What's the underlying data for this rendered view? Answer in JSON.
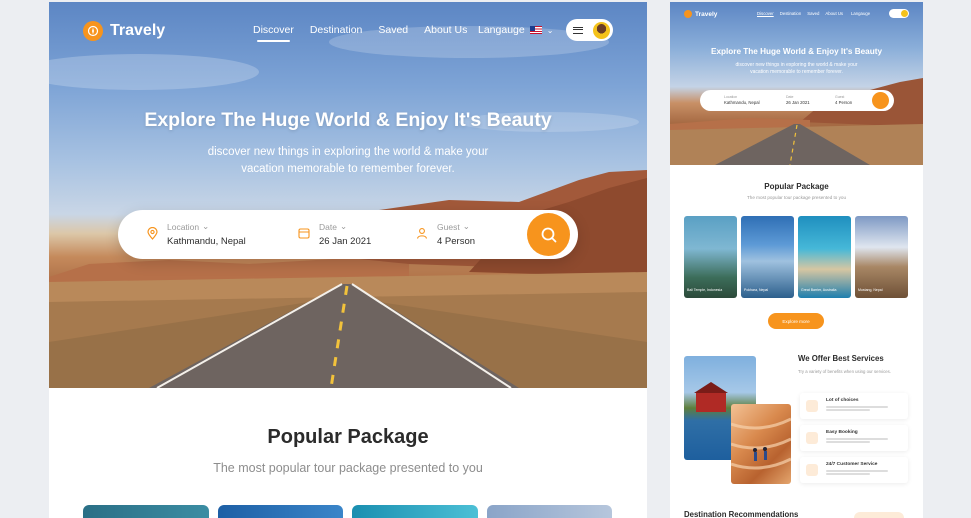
{
  "brand": {
    "name": "Travely",
    "accent": "#f7941d"
  },
  "nav": {
    "items": [
      {
        "label": "Discover",
        "active": true
      },
      {
        "label": "Destination",
        "active": false
      },
      {
        "label": "Saved",
        "active": false
      },
      {
        "label": "About Us",
        "active": false
      }
    ],
    "language_label": "Langauge"
  },
  "hero": {
    "title": "Explore The Huge World & Enjoy It's Beauty",
    "subtitle": "discover new things in exploring the world & make your vacation memorable to remember forever."
  },
  "search": {
    "location": {
      "label": "Location",
      "value": "Kathmandu, Nepal"
    },
    "date": {
      "label": "Date",
      "value": "26 Jan 2021"
    },
    "guest": {
      "label": "Guest",
      "value": "4 Person"
    }
  },
  "popular": {
    "title": "Popular Package",
    "subtitle": "The most popular tour package presented to you"
  },
  "mini": {
    "brand": "Travely",
    "nav": [
      "Discover",
      "Destination",
      "Saved",
      "About Us"
    ],
    "language_label": "Langauge",
    "hero_title": "Explore The Huge World & Enjoy It's Beauty",
    "hero_subtitle": "discover new things in exploring the world & make your vacation memorable to remember forever.",
    "search": [
      {
        "label": "Location",
        "value": "Kathmandu, Nepal"
      },
      {
        "label": "Date",
        "value": "26 Jan 2021"
      },
      {
        "label": "Guest",
        "value": "4 Person"
      }
    ],
    "popular_title": "Popular Package",
    "popular_subtitle": "The most popular tour package presented to you",
    "packages": [
      "Bali Temple, Indonesia",
      "Pokhara, Nepal",
      "Great Barrier, Australia",
      "Mustang, Nepal"
    ],
    "explore_label": "Explore more",
    "services_title": "We Offer Best Services",
    "services_subtitle": "Try a variety of benefits when using our services.",
    "services": [
      "Lot of choices",
      "Easy Booking",
      "24/7 Customer Service"
    ],
    "destination_title": "Destination Recommendations"
  }
}
